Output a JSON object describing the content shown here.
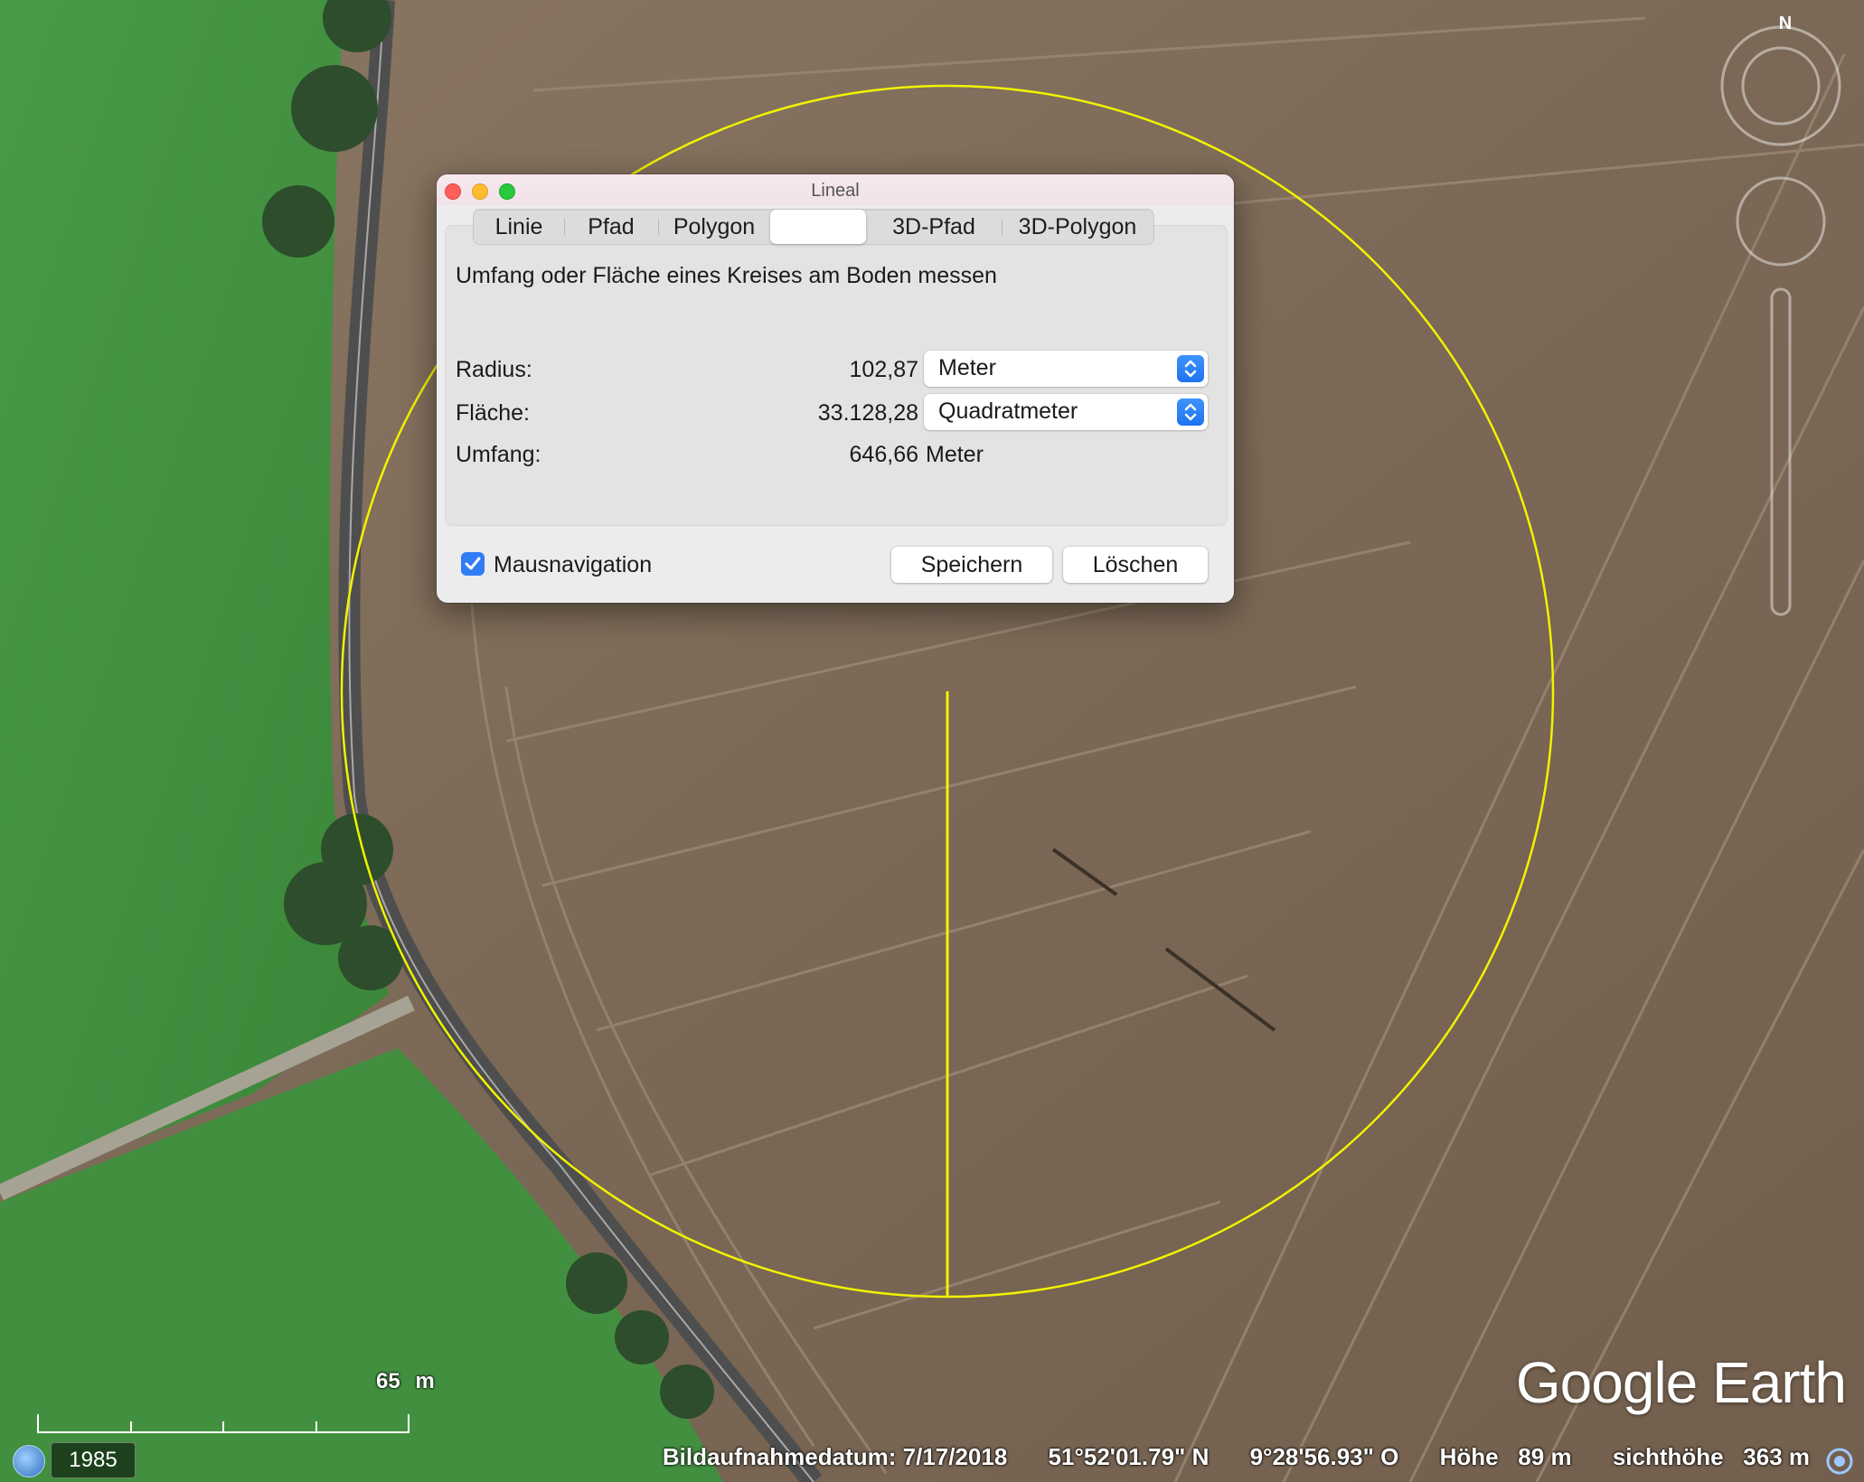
{
  "dialog": {
    "title": "Lineal",
    "tabs": [
      "Linie",
      "Pfad",
      "Polygon",
      "",
      "3D-Pfad",
      "3D-Polygon"
    ],
    "active_tab": 3,
    "description": "Umfang oder Fläche eines Kreises am Boden messen",
    "radius": {
      "label": "Radius:",
      "value": "102,87",
      "unit": "Meter"
    },
    "area": {
      "label": "Fläche:",
      "value": "33.128,28",
      "unit": "Quadratmeter"
    },
    "circumference": {
      "label": "Umfang:",
      "value": "646,66",
      "unit": "Meter"
    },
    "mouse_navigation": {
      "label": "Mausnavigation",
      "checked": true
    },
    "save_label": "Speichern",
    "delete_label": "Löschen"
  },
  "map": {
    "scale_label": "65 m",
    "year_label": "1985",
    "brand": "Google Earth",
    "compass_label": "N",
    "status": {
      "capture_date": "Bildaufnahmedatum: 7/17/2018",
      "latitude": "51°52'01.79\" N",
      "longitude": "9°28'56.93\" O",
      "elevation": "Höhe   89 m",
      "eye_altitude": "sichthöhe   363 m"
    },
    "colors": {
      "measure_line": "#f2f200",
      "field": "#7d6a58",
      "meadow": "#3f8e3f",
      "road": "#4e4e4e"
    }
  }
}
